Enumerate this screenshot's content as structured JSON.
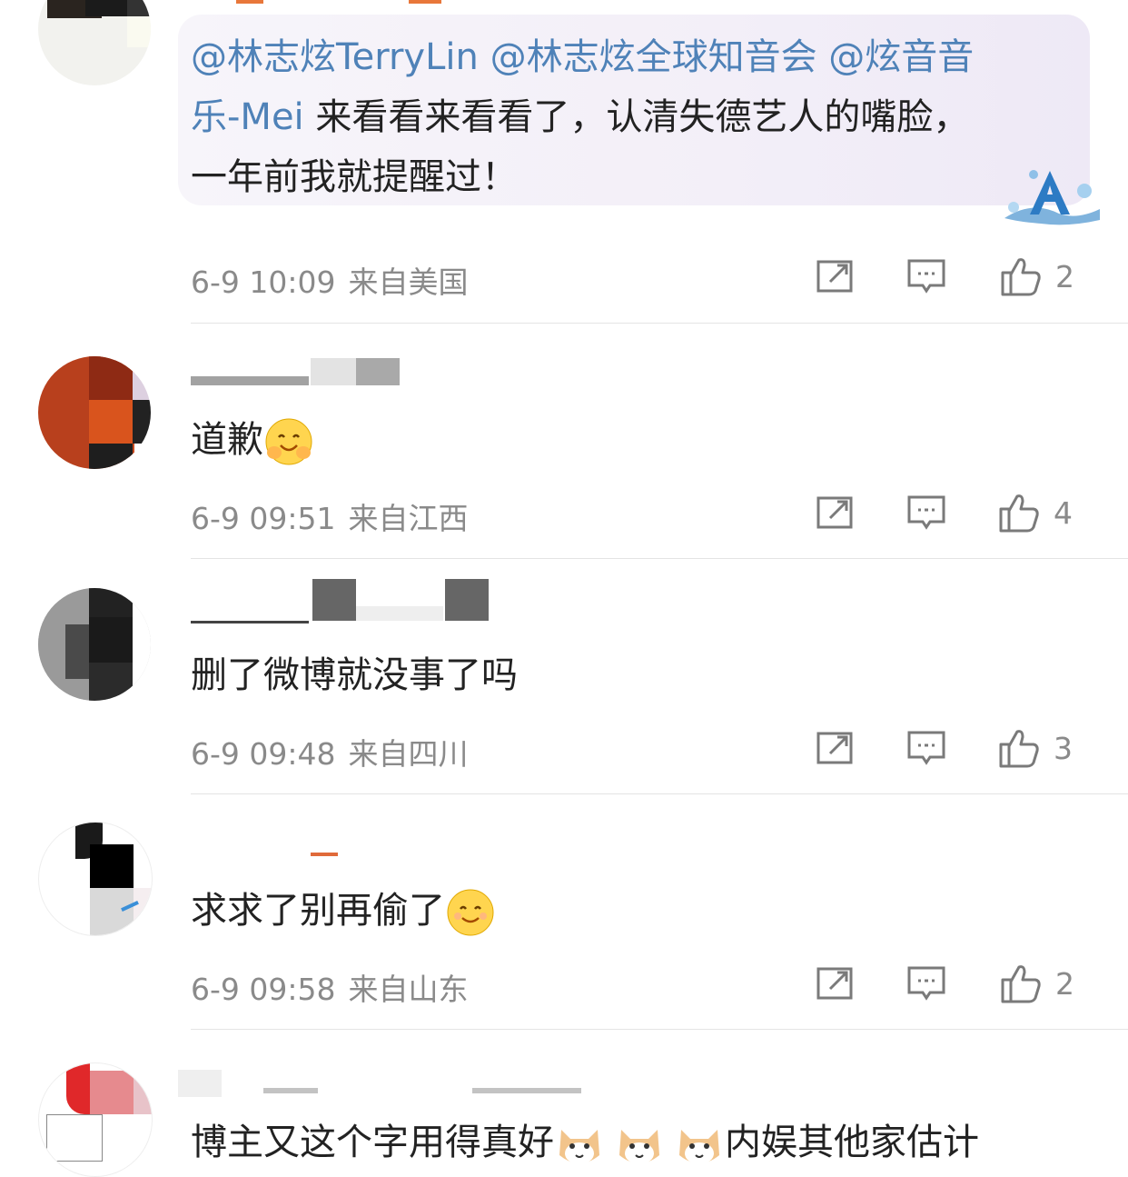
{
  "comments": [
    {
      "mentions": [
        "@林志炫TerryLin",
        "@林志炫全球知音会",
        "@炫音音乐-Mei"
      ],
      "text_line1_mentions": "@林志炫TerryLin @林志炫全球知音会 @炫音音",
      "text_line2_mention": "乐-Mei",
      "text_line2_rest": " 来看看来看看了，认清失德艺人的嘴脸，",
      "text_line3": "一年前我就提醒过！",
      "date": "6-9 10:09",
      "location": "来自美国",
      "likes": "2"
    },
    {
      "text": "道歉",
      "emoji": "hug-emoji",
      "date": "6-9 09:51",
      "location": "来自江西",
      "likes": "4"
    },
    {
      "text": "删了微博就没事了吗",
      "date": "6-9 09:48",
      "location": "来自四川",
      "likes": "3"
    },
    {
      "text": "求求了别再偷了",
      "emoji": "smile-emoji",
      "date": "6-9 09:58",
      "location": "来自山东",
      "likes": "2"
    },
    {
      "text_part1": "博主又这个字用得真好",
      "emoji": "cat-emoji",
      "text_part2": "内娱其他家估计"
    }
  ],
  "colors": {
    "mention": "#4f82b8",
    "meta": "#8a8a8a",
    "divider": "#e4e4e4"
  },
  "icons": [
    "share-icon",
    "comment-icon",
    "like-icon"
  ]
}
